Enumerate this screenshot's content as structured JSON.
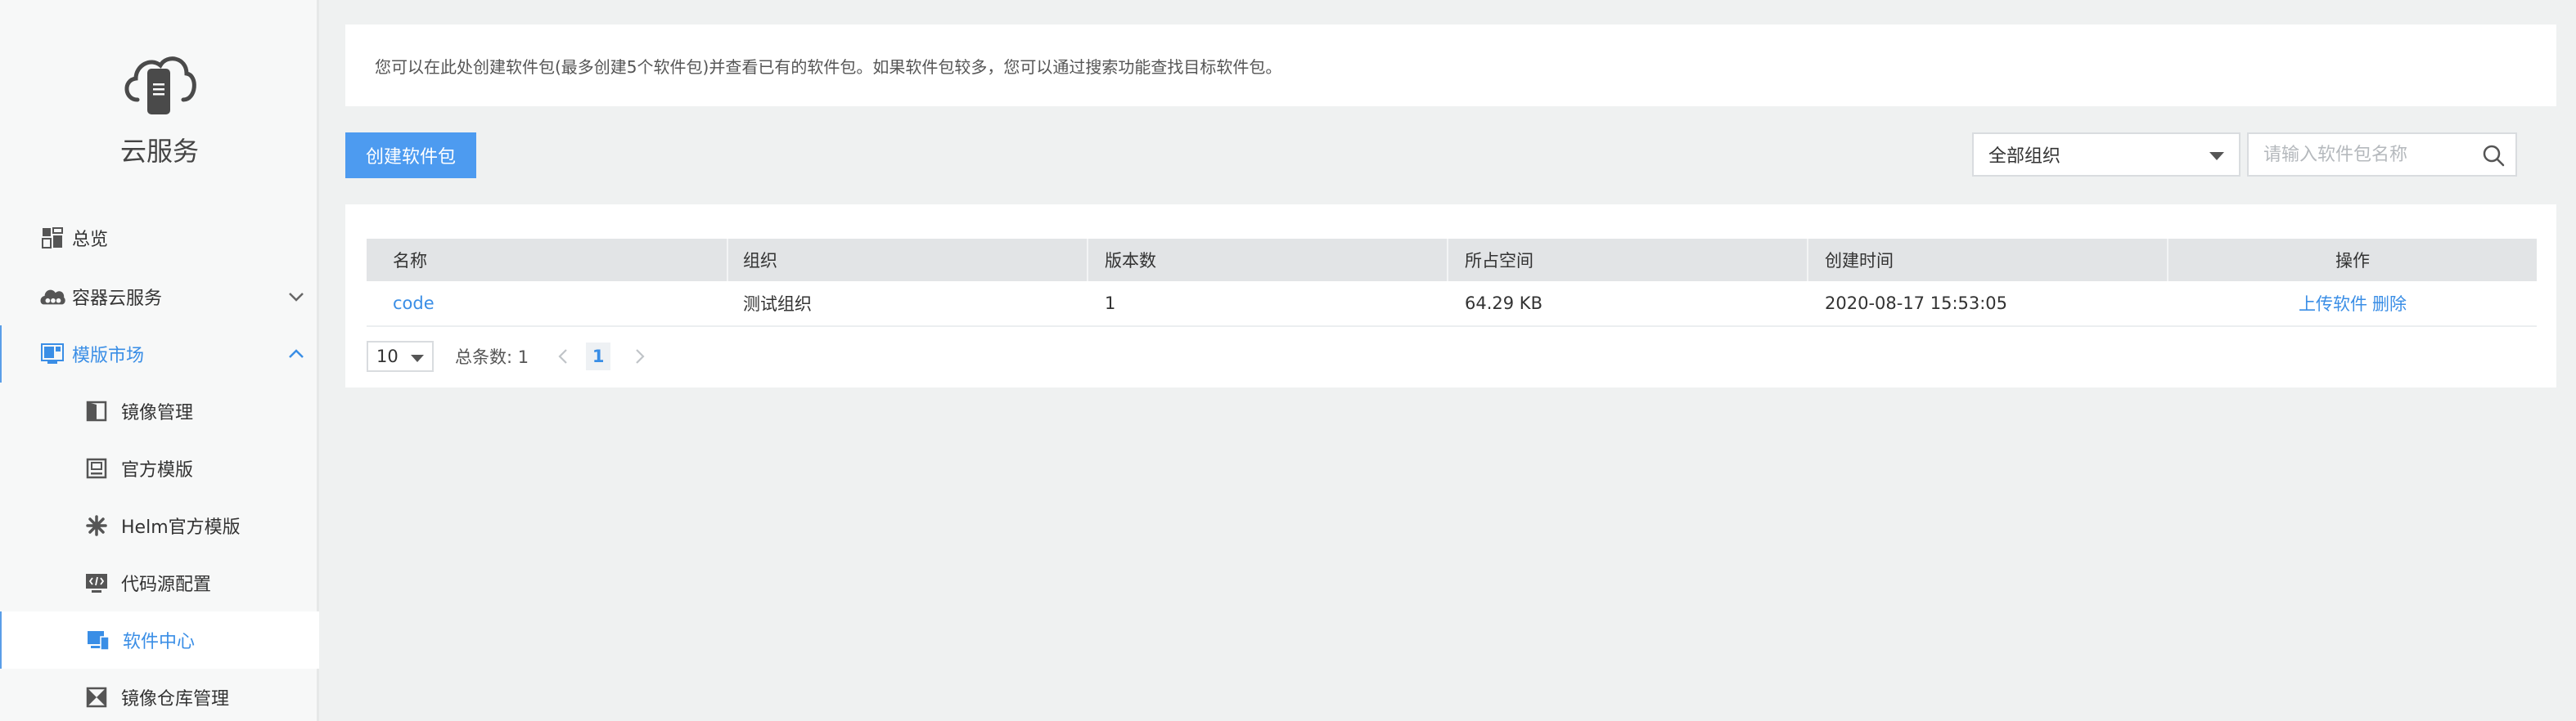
{
  "brand": {
    "title": "云服务"
  },
  "sidebar": {
    "items": [
      {
        "label": "总览",
        "icon": "dashboard-icon"
      },
      {
        "label": "容器云服务",
        "icon": "cloud-cluster-icon"
      },
      {
        "label": "模版市场",
        "icon": "template-market-icon"
      },
      {
        "label": "镜像管理",
        "icon": "image-icon"
      },
      {
        "label": "官方模版",
        "icon": "official-template-icon"
      },
      {
        "label": "Helm官方模版",
        "icon": "helm-icon"
      },
      {
        "label": "代码源配置",
        "icon": "code-source-icon"
      },
      {
        "label": "软件中心",
        "icon": "software-center-icon"
      },
      {
        "label": "镜像仓库管理",
        "icon": "registry-icon"
      }
    ]
  },
  "notice": {
    "text": "您可以在此处创建软件包(最多创建5个软件包)并查看已有的软件包。如果软件包较多，您可以通过搜索功能查找目标软件包。"
  },
  "toolbar": {
    "create_label": "创建软件包",
    "org_select_value": "全部组织",
    "search_placeholder": "请输入软件包名称"
  },
  "table": {
    "columns": [
      "名称",
      "组织",
      "版本数",
      "所占空间",
      "创建时间",
      "操作"
    ],
    "rows": [
      {
        "name": "code",
        "org": "测试组织",
        "versions": "1",
        "space": "64.29 KB",
        "created": "2020-08-17 15:53:05",
        "action_upload": "上传软件",
        "action_delete": "删除"
      }
    ]
  },
  "pagination": {
    "page_size": "10",
    "total_label": "总条数: 1",
    "current_page": "1"
  },
  "colors": {
    "accent": "#3a8ee6",
    "primary_button": "#4d9bf0",
    "header_bg": "#e2e4e6"
  }
}
